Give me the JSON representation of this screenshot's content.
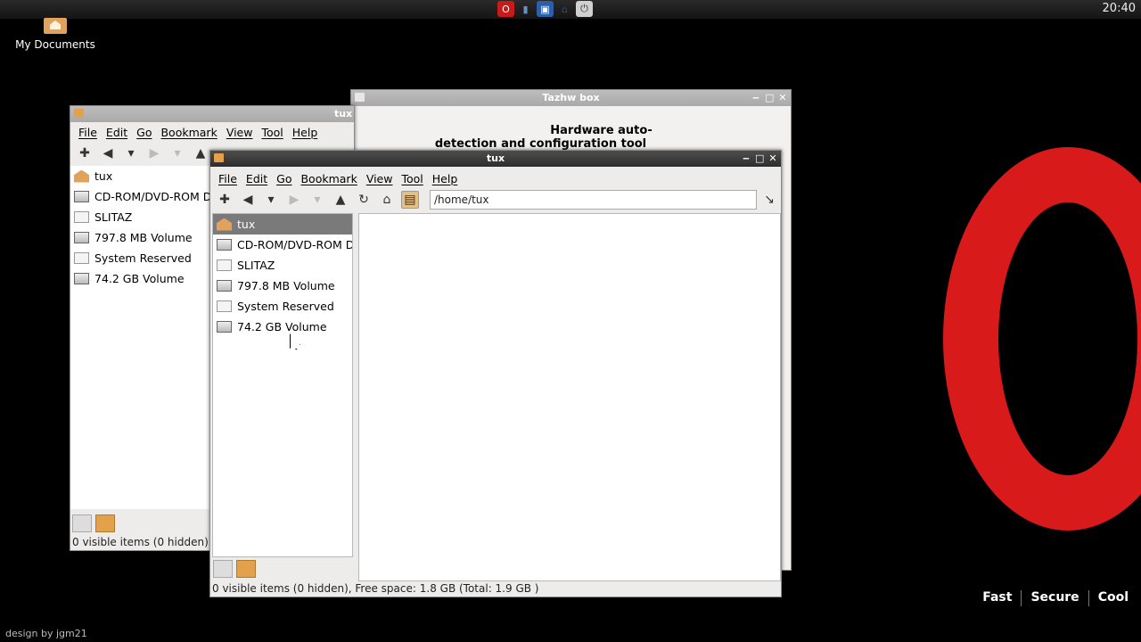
{
  "top_panel": {
    "tray_icons": [
      "opera-icon",
      "signal-icon",
      "network-icon",
      "home-icon",
      "power-icon"
    ],
    "clock": "20:40"
  },
  "desktop": {
    "icon_label": "My Documents",
    "slogans": [
      "Fast",
      "Secure",
      "Cool"
    ],
    "credit": "design by jgm21"
  },
  "tazhw_window": {
    "title": "Tazhw box",
    "heading_line1": "Hardware auto-",
    "heading_line2": "detection and configuration tool"
  },
  "back_window": {
    "title": "tux",
    "menu": [
      "File",
      "Edit",
      "Go",
      "Bookmark",
      "View",
      "Tool",
      "Help"
    ],
    "places": [
      {
        "label": "tux",
        "icon": "home"
      },
      {
        "label": "CD-ROM/DVD-ROM Dri",
        "icon": "drive"
      },
      {
        "label": "SLITAZ",
        "icon": "disk"
      },
      {
        "label": "797.8 MB Volume",
        "icon": "drive"
      },
      {
        "label": "System Reserved",
        "icon": "disk"
      },
      {
        "label": "74.2 GB Volume",
        "icon": "drive"
      }
    ],
    "status": "0 visible items (0 hidden)"
  },
  "front_window": {
    "title": "tux",
    "menu": [
      "File",
      "Edit",
      "Go",
      "Bookmark",
      "View",
      "Tool",
      "Help"
    ],
    "address": "/home/tux",
    "places": [
      {
        "label": "tux",
        "icon": "home",
        "selected": true
      },
      {
        "label": "CD-ROM/DVD-ROM Dri",
        "icon": "drive"
      },
      {
        "label": "SLITAZ",
        "icon": "disk"
      },
      {
        "label": "797.8 MB Volume",
        "icon": "drive"
      },
      {
        "label": "System Reserved",
        "icon": "disk"
      },
      {
        "label": "74.2 GB Volume",
        "icon": "drive"
      }
    ],
    "status": "0 visible items (0 hidden), Free space: 1.8 GB (Total: 1.9 GB )"
  }
}
